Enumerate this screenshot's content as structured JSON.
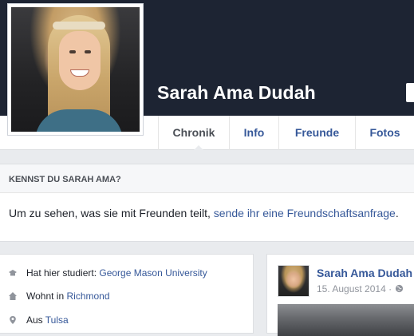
{
  "profile": {
    "name": "Sarah Ama Dudah"
  },
  "tabs": [
    {
      "label": "Chronik",
      "active": true
    },
    {
      "label": "Info",
      "active": false
    },
    {
      "label": "Freunde",
      "active": false
    },
    {
      "label": "Fotos",
      "active": false
    }
  ],
  "friend_box": {
    "title": "KENNST DU SARAH AMA?",
    "text": "Um zu sehen, was sie mit Freunden teilt, ",
    "link": "sende ihr eine Freundschaftsanfrage",
    "suffix": "."
  },
  "intro": {
    "school": {
      "prefix": "Hat hier studiert: ",
      "link": "George Mason University",
      "icon": "school-icon"
    },
    "lives": {
      "prefix": "Wohnt in ",
      "link": "Richmond",
      "icon": "home-icon"
    },
    "from": {
      "prefix": "Aus ",
      "link": "Tulsa",
      "icon": "location-pin-icon"
    }
  },
  "post": {
    "author": "Sarah Ama Dudah",
    "date": "15. August 2014 · ",
    "privacy_icon": "globe-icon"
  },
  "colors": {
    "cover": "#1d2433",
    "link": "#365899",
    "background": "#e9ebee"
  }
}
